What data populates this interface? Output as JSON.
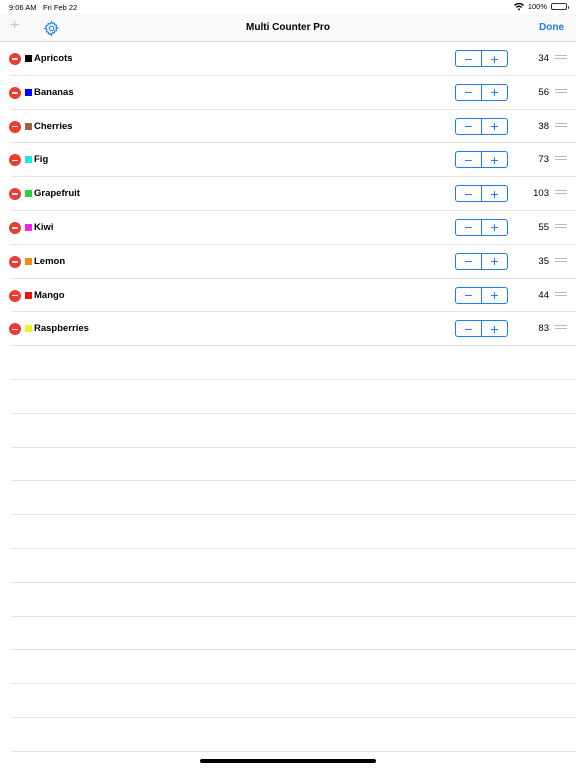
{
  "status_bar": {
    "time": "9:06 AM",
    "date": "Fri Feb 22",
    "battery": "100%",
    "wifi_icon": "wifi-icon",
    "battery_icon": "battery-icon"
  },
  "nav": {
    "add_label": "+",
    "settings_icon": "gear-icon",
    "title": "Multi Counter Pro",
    "done_label": "Done"
  },
  "accent_color": "#1a7cf0",
  "delete_color": "#ee3b32",
  "stepper": {
    "minus_label": "−",
    "plus_label": "+"
  },
  "counters": [
    {
      "name": "Apricots",
      "color": "#000000",
      "count": "34"
    },
    {
      "name": "Bananas",
      "color": "#0000ff",
      "count": "56"
    },
    {
      "name": "Cherries",
      "color": "#9c6644",
      "count": "38"
    },
    {
      "name": "Fig",
      "color": "#22e6ee",
      "count": "73"
    },
    {
      "name": "Grapefruit",
      "color": "#22d33a",
      "count": "103"
    },
    {
      "name": "Kiwi",
      "color": "#ef22ee",
      "count": "55"
    },
    {
      "name": "Lemon",
      "color": "#f58a12",
      "count": "35"
    },
    {
      "name": "Mango",
      "color": "#ee1111",
      "count": "44"
    },
    {
      "name": "Raspberries",
      "color": "#f4f020",
      "count": "83"
    }
  ]
}
